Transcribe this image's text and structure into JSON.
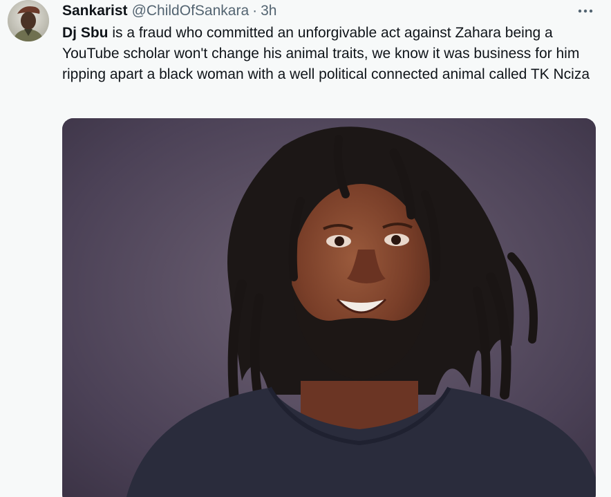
{
  "tweet": {
    "author": {
      "name": "Sankarist",
      "handle": "@ChildOfSankara",
      "separator": "·",
      "timestamp": "3h"
    },
    "text_mention": "Dj Sbu",
    "text_rest": " is a fraud who committed an unforgivable act against Zahara being a YouTube scholar won't change his animal traits, we know it was business for him ripping apart a black woman with a well political connected animal called TK Nciza",
    "more_icon": "more-horizontal-icon",
    "media": {
      "type": "photo",
      "description_icon": "portrait-photo"
    }
  },
  "colors": {
    "background": "#f7f9f9",
    "text_primary": "#0f1419",
    "text_secondary": "#536471"
  }
}
